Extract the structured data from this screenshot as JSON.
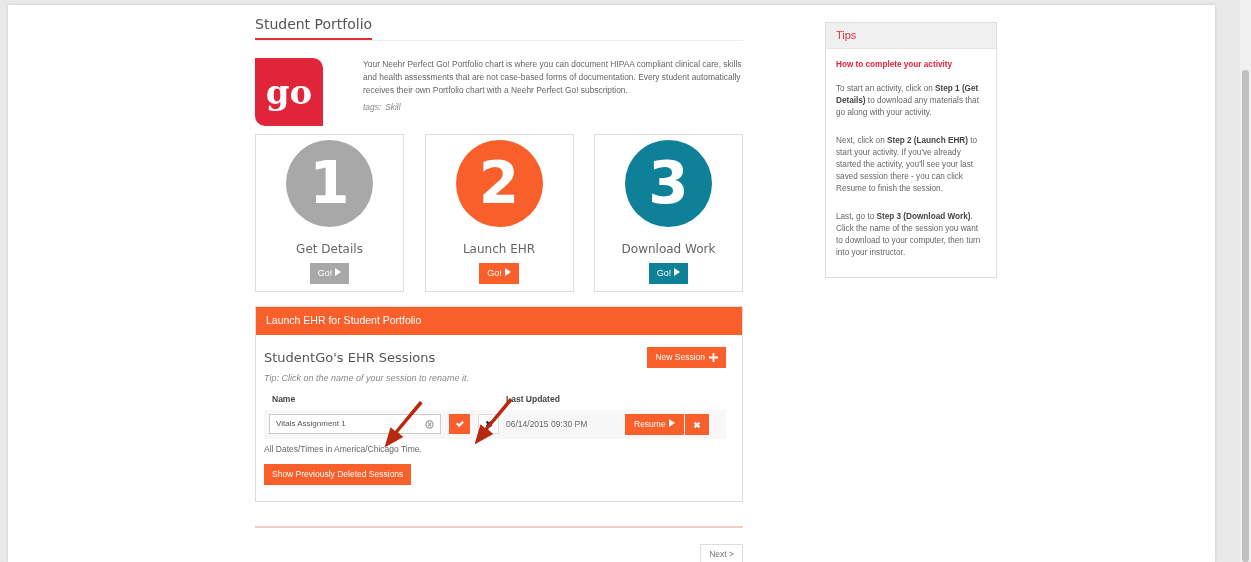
{
  "page_title": "Student Portfolio",
  "logo": {
    "text": "go"
  },
  "description": "Your Neehr Perfect Go! Portfolio chart is where you can document HIPAA compliant clinical care, skills and health assessments that are not case-based forms of documentation. Every student automatically receives their own Portfolio chart with a Neehr Perfect Go! subscription.",
  "tags": {
    "label": "tags:",
    "value": "Skill"
  },
  "steps": [
    {
      "number": "1",
      "label": "Get Details",
      "button": "Go!",
      "color": "#a8a8a8"
    },
    {
      "number": "2",
      "label": "Launch EHR",
      "button": "Go!",
      "color": "#f95f2a"
    },
    {
      "number": "3",
      "label": "Download Work",
      "button": "Go!",
      "color": "#0e8198"
    }
  ],
  "panel": {
    "header": "Launch EHR for Student Portfolio",
    "heading": "StudentGo's EHR Sessions",
    "new_button": "New Session",
    "tip": "Tip: Click on the name of your session to rename it.",
    "columns": [
      "Name",
      "Last Updated"
    ],
    "sessions": [
      {
        "name": "Vitals Assignment 1",
        "editing": true,
        "updated": "06/14/2015 09:30 PM",
        "resume": "Resume"
      }
    ],
    "timezone_note": "All Dates/Times in America/Chicago Time.",
    "deleted_button": "Show Previously Deleted Sessions"
  },
  "next_button": "Next >",
  "tips": {
    "title": "Tips",
    "heading": "How to complete your activity",
    "paragraphs": [
      "To start an activity, click on **Step 1 (Get Details)** to download any materials that go along with your activity.",
      "Next, click on **Step 2 (Launch EHR)** to start your activity. If you've already started the activity, you'll see your last saved session there - you can click Resume to finish the session.",
      "Last, go to **Step 3 (Download Work)**. Click the name of the session you want to download to your computer, then turn into your instructor."
    ]
  }
}
